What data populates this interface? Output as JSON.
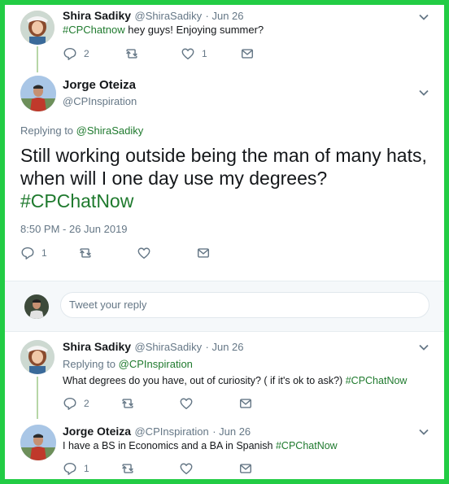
{
  "tweet1": {
    "name": "Shira Sadiky",
    "handle": "@ShiraSadiky",
    "date": "· Jun 26",
    "text": "hey guys! Enjoying summer?",
    "hashtag": "#CPChatnow",
    "reply_count": "2",
    "like_count": "1"
  },
  "main": {
    "name": "Jorge Oteiza",
    "handle": "@CPInspiration",
    "replying_prefix": "Replying to",
    "replying_to": "@ShiraSadiky",
    "text": "Still working outside being the man of many hats, when will I one day use my degrees?",
    "hashtag": "#CPChatNow",
    "timestamp": "8:50 PM - 26 Jun 2019",
    "reply_count": "1"
  },
  "reply_box": {
    "placeholder": "Tweet your reply"
  },
  "tweet3": {
    "name": "Shira Sadiky",
    "handle": "@ShiraSadiky",
    "date": "· Jun 26",
    "replying_prefix": "Replying to",
    "replying_to": "@CPInspiration",
    "text": "What degrees do you have, out of curiosity? ( if it's ok to ask?)",
    "hashtag": "#CPChatNow",
    "reply_count": "2"
  },
  "tweet4": {
    "name": "Jorge Oteiza",
    "handle": "@CPInspiration",
    "date": "· Jun 26",
    "text": "I have a BS in Economics and a BA in Spanish",
    "hashtag": "#CPChatNow",
    "reply_count": "1"
  },
  "colors": {
    "border": "#22cc44",
    "hashtag": "#1f7a2e",
    "icon": "#657786"
  },
  "icons": [
    "reply-icon",
    "retweet-icon",
    "like-icon",
    "message-icon",
    "chevron-down-icon"
  ]
}
